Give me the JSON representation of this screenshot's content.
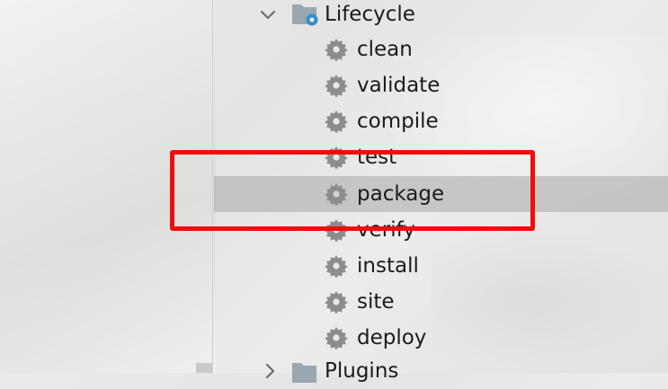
{
  "tree": {
    "lifecycle_label": "Lifecycle",
    "phases": [
      {
        "label": "clean"
      },
      {
        "label": "validate"
      },
      {
        "label": "compile"
      },
      {
        "label": "test"
      },
      {
        "label": "package",
        "selected": true
      },
      {
        "label": "verify"
      },
      {
        "label": "install"
      },
      {
        "label": "site"
      },
      {
        "label": "deploy"
      }
    ],
    "plugins_label": "Plugins"
  },
  "icons": {
    "expand": "chevron-down-icon",
    "collapse": "chevron-right-icon",
    "folder": "folder-gear-icon",
    "phase": "gear-icon"
  },
  "colors": {
    "highlight_border": "#f20d0d",
    "selection": "#b9b9b7",
    "gear": "#8c8c8c",
    "folder_body": "#9aa6b2",
    "folder_gear": "#3592c4"
  }
}
